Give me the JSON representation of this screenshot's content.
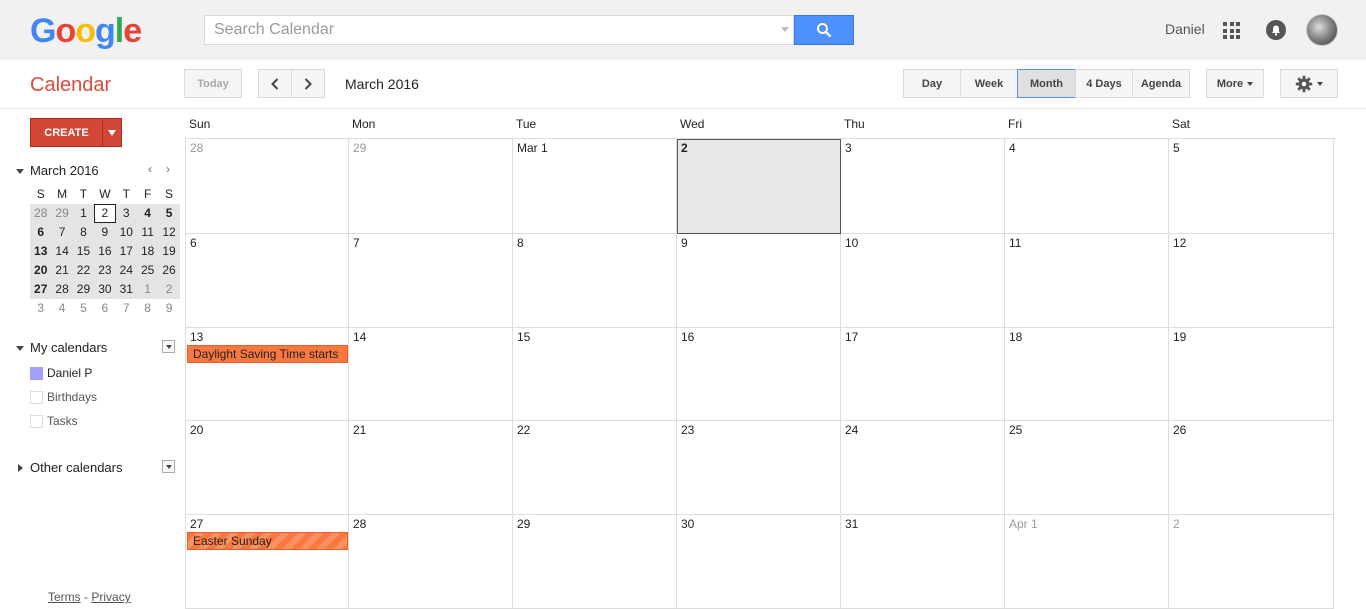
{
  "header": {
    "logo_letters": [
      {
        "ch": "G",
        "color": "#4285f4"
      },
      {
        "ch": "o",
        "color": "#ea4335"
      },
      {
        "ch": "o",
        "color": "#fbbc05"
      },
      {
        "ch": "g",
        "color": "#4285f4"
      },
      {
        "ch": "l",
        "color": "#34a853"
      },
      {
        "ch": "e",
        "color": "#ea4335"
      }
    ],
    "search_placeholder": "Search Calendar",
    "user_name": "Daniel",
    "icons": [
      "search-icon",
      "apps-grid-icon",
      "notifications-bell-icon",
      "avatar"
    ]
  },
  "toolbar": {
    "app_title": "Calendar",
    "today_label": "Today",
    "date_range": "March 2016",
    "views": [
      "Day",
      "Week",
      "Month",
      "4 Days",
      "Agenda"
    ],
    "active_view": "Month",
    "more_label": "More"
  },
  "sidebar": {
    "create_label": "CREATE",
    "mini_calendar": {
      "title": "March 2016",
      "weekdays": [
        "S",
        "M",
        "T",
        "W",
        "T",
        "F",
        "S"
      ],
      "weeks": [
        [
          "28",
          "29",
          "1",
          "2",
          "3",
          "4",
          "5"
        ],
        [
          "6",
          "7",
          "8",
          "9",
          "10",
          "11",
          "12"
        ],
        [
          "13",
          "14",
          "15",
          "16",
          "17",
          "18",
          "19"
        ],
        [
          "20",
          "21",
          "22",
          "23",
          "24",
          "25",
          "26"
        ],
        [
          "27",
          "28",
          "29",
          "30",
          "31",
          "1",
          "2"
        ],
        [
          "3",
          "4",
          "5",
          "6",
          "7",
          "8",
          "9"
        ]
      ],
      "today": "2"
    },
    "my_calendars_title": "My calendars",
    "my_calendars": [
      {
        "name": "Daniel P",
        "color": "#9fa0fb",
        "checked": true
      },
      {
        "name": "Birthdays",
        "color": "#ffffff",
        "checked": false
      },
      {
        "name": "Tasks",
        "color": "#ffffff",
        "checked": false
      }
    ],
    "other_calendars_title": "Other calendars",
    "footer": {
      "terms": "Terms",
      "separator": "-",
      "privacy": "Privacy"
    }
  },
  "month": {
    "weekday_headers": [
      "Sun",
      "Mon",
      "Tue",
      "Wed",
      "Thu",
      "Fri",
      "Sat"
    ],
    "weeks": [
      [
        {
          "label": "28",
          "other": true
        },
        {
          "label": "29",
          "other": true
        },
        {
          "label": "Mar 1"
        },
        {
          "label": "2",
          "today": true
        },
        {
          "label": "3"
        },
        {
          "label": "4"
        },
        {
          "label": "5"
        }
      ],
      [
        {
          "label": "6"
        },
        {
          "label": "7"
        },
        {
          "label": "8"
        },
        {
          "label": "9"
        },
        {
          "label": "10"
        },
        {
          "label": "11"
        },
        {
          "label": "12"
        }
      ],
      [
        {
          "label": "13",
          "event": "Daylight Saving Time starts"
        },
        {
          "label": "14"
        },
        {
          "label": "15"
        },
        {
          "label": "16"
        },
        {
          "label": "17"
        },
        {
          "label": "18"
        },
        {
          "label": "19"
        }
      ],
      [
        {
          "label": "20"
        },
        {
          "label": "21"
        },
        {
          "label": "22"
        },
        {
          "label": "23"
        },
        {
          "label": "24"
        },
        {
          "label": "25"
        },
        {
          "label": "26"
        }
      ],
      [
        {
          "label": "27",
          "event": "Easter Sunday",
          "striped": true
        },
        {
          "label": "28"
        },
        {
          "label": "29"
        },
        {
          "label": "30"
        },
        {
          "label": "31"
        },
        {
          "label": "Apr 1",
          "other": true
        },
        {
          "label": "2",
          "other": true
        }
      ]
    ],
    "event_color": "#fa773f"
  }
}
